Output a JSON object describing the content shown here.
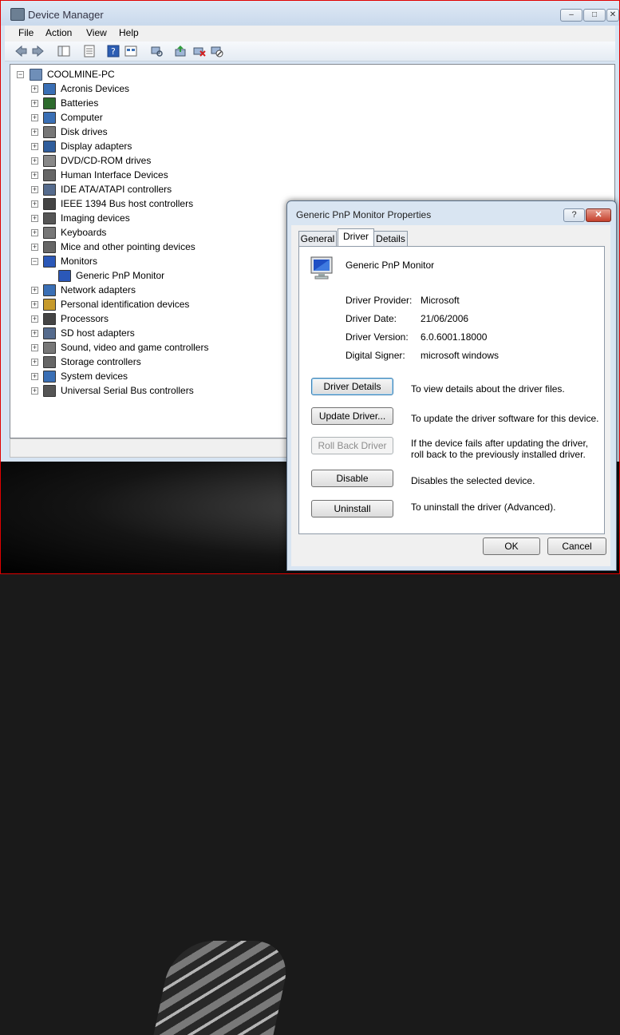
{
  "window": {
    "title": "Device Manager",
    "minimize": "‒",
    "maximize": "□",
    "close": "✕"
  },
  "menu": [
    "File",
    "Action",
    "View",
    "Help"
  ],
  "tree": {
    "root": "COOLMINE-PC",
    "categories": [
      {
        "label": "Acronis Devices",
        "icon": "device-icon",
        "color": "#3a6fb5"
      },
      {
        "label": "Batteries",
        "icon": "battery-icon",
        "color": "#2d6b2d"
      },
      {
        "label": "Computer",
        "icon": "computer-icon",
        "color": "#3a6fb5"
      },
      {
        "label": "Disk drives",
        "icon": "disk-drive-icon",
        "color": "#777777"
      },
      {
        "label": "Display adapters",
        "icon": "display-adapter-icon",
        "color": "#2f5d9c"
      },
      {
        "label": "DVD/CD-ROM drives",
        "icon": "dvd-drive-icon",
        "color": "#888888"
      },
      {
        "label": "Human Interface Devices",
        "icon": "hid-icon",
        "color": "#666666"
      },
      {
        "label": "IDE ATA/ATAPI controllers",
        "icon": "ide-controller-icon",
        "color": "#556b8d"
      },
      {
        "label": "IEEE 1394 Bus host controllers",
        "icon": "ieee1394-icon",
        "color": "#444444"
      },
      {
        "label": "Imaging devices",
        "icon": "camera-icon",
        "color": "#555555"
      },
      {
        "label": "Keyboards",
        "icon": "keyboard-icon",
        "color": "#777777"
      },
      {
        "label": "Mice and other pointing devices",
        "icon": "mouse-icon",
        "color": "#666666"
      },
      {
        "label": "Monitors",
        "icon": "monitor-icon",
        "color": "#2b58b8",
        "expanded": true,
        "children": [
          "Generic PnP Monitor"
        ]
      },
      {
        "label": "Network adapters",
        "icon": "network-icon",
        "color": "#3a6fb5"
      },
      {
        "label": "Personal identification devices",
        "icon": "fingerprint-icon",
        "color": "#c69a2b"
      },
      {
        "label": "Processors",
        "icon": "processor-icon",
        "color": "#444444"
      },
      {
        "label": "SD host adapters",
        "icon": "sd-card-icon",
        "color": "#556b8d"
      },
      {
        "label": "Sound, video and game controllers",
        "icon": "speaker-icon",
        "color": "#777777"
      },
      {
        "label": "Storage controllers",
        "icon": "storage-icon",
        "color": "#666666"
      },
      {
        "label": "System devices",
        "icon": "system-icon",
        "color": "#3a6fb5"
      },
      {
        "label": "Universal Serial Bus controllers",
        "icon": "usb-icon",
        "color": "#555555"
      }
    ]
  },
  "dialog": {
    "title": "Generic PnP Monitor Properties",
    "help": "?",
    "close": "✕",
    "tabs": [
      "General",
      "Driver",
      "Details"
    ],
    "active_tab": "Driver",
    "device_name": "Generic PnP Monitor",
    "fields": [
      {
        "label": "Driver Provider:",
        "value": "Microsoft"
      },
      {
        "label": "Driver Date:",
        "value": "21/06/2006"
      },
      {
        "label": "Driver Version:",
        "value": "6.0.6001.18000"
      },
      {
        "label": "Digital Signer:",
        "value": "microsoft windows"
      }
    ],
    "actions": [
      {
        "button": "Driver Details",
        "desc": "To view details about the driver files."
      },
      {
        "button": "Update Driver...",
        "desc": "To update the driver software for this device."
      },
      {
        "button": "Roll Back Driver",
        "desc": "If the device fails after updating the driver, roll back to the previously installed driver."
      },
      {
        "button": "Disable",
        "desc": "Disables the selected device."
      },
      {
        "button": "Uninstall",
        "desc": "To uninstall the driver (Advanced)."
      }
    ],
    "ok": "OK",
    "cancel": "Cancel"
  }
}
